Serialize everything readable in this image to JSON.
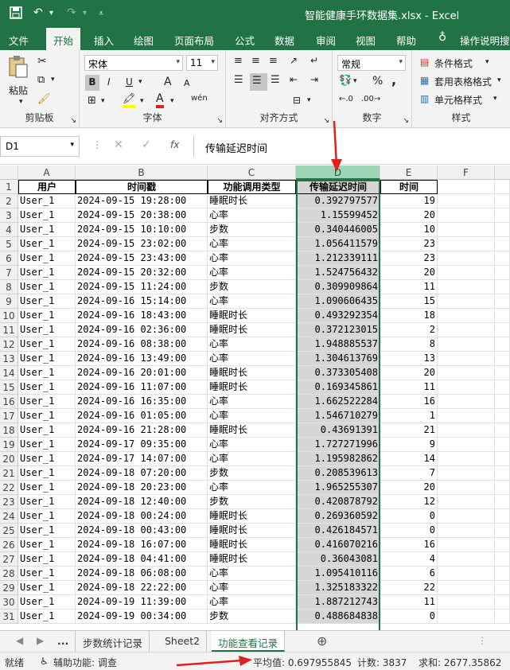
{
  "window": {
    "title": "智能健康手环数据集.xlsx  -  Excel"
  },
  "quick_access": {
    "save": "💾",
    "undo": "↶",
    "redo": "↷",
    "customize": "⌄"
  },
  "tabs": [
    "文件",
    "开始",
    "插入",
    "绘图",
    "页面布局",
    "公式",
    "数据",
    "审阅",
    "视图",
    "帮助"
  ],
  "active_tab": "开始",
  "tell_me": "操作说明搜",
  "ribbon": {
    "clipboard": {
      "label": "剪贴板",
      "paste": "粘贴"
    },
    "font": {
      "label": "字体",
      "name": "宋体",
      "size": "11",
      "bold": "B",
      "italic": "I",
      "underline": "U",
      "grow": "A",
      "shrink": "A",
      "wen": "wén"
    },
    "alignment": {
      "label": "对齐方式"
    },
    "number": {
      "label": "数字",
      "format": "常规",
      "percent": "%",
      "comma": ","
    },
    "styles": {
      "label": "样式",
      "conditional": "条件格式",
      "table": "套用表格格式",
      "cell": "单元格样式"
    }
  },
  "formula_bar": {
    "name_box": "D1",
    "fx": "fx",
    "content": "传输延迟时间"
  },
  "columns": [
    "A",
    "B",
    "C",
    "D",
    "E",
    "F"
  ],
  "selected_column": "D",
  "header_row": [
    "用户",
    "时间戳",
    "功能调用类型",
    "传输延迟时间",
    "时间"
  ],
  "rows": [
    [
      "User_1",
      "2024-09-15 19:28:00",
      "睡眠时长",
      "0.392797577",
      "19"
    ],
    [
      "User_1",
      "2024-09-15 20:38:00",
      "心率",
      "1.15599452",
      "20"
    ],
    [
      "User_1",
      "2024-09-15 10:10:00",
      "步数",
      "0.340446005",
      "10"
    ],
    [
      "User_1",
      "2024-09-15 23:02:00",
      "心率",
      "1.056411579",
      "23"
    ],
    [
      "User_1",
      "2024-09-15 23:43:00",
      "心率",
      "1.212339111",
      "23"
    ],
    [
      "User_1",
      "2024-09-15 20:32:00",
      "心率",
      "1.524756432",
      "20"
    ],
    [
      "User_1",
      "2024-09-15 11:24:00",
      "步数",
      "0.309909864",
      "11"
    ],
    [
      "User_1",
      "2024-09-16 15:14:00",
      "心率",
      "1.090606435",
      "15"
    ],
    [
      "User_1",
      "2024-09-16 18:43:00",
      "睡眠时长",
      "0.493292354",
      "18"
    ],
    [
      "User_1",
      "2024-09-16 02:36:00",
      "睡眠时长",
      "0.372123015",
      "2"
    ],
    [
      "User_1",
      "2024-09-16 08:38:00",
      "心率",
      "1.948885537",
      "8"
    ],
    [
      "User_1",
      "2024-09-16 13:49:00",
      "心率",
      "1.304613769",
      "13"
    ],
    [
      "User_1",
      "2024-09-16 20:01:00",
      "睡眠时长",
      "0.373305408",
      "20"
    ],
    [
      "User_1",
      "2024-09-16 11:07:00",
      "睡眠时长",
      "0.169345861",
      "11"
    ],
    [
      "User_1",
      "2024-09-16 16:35:00",
      "心率",
      "1.662522284",
      "16"
    ],
    [
      "User_1",
      "2024-09-16 01:05:00",
      "心率",
      "1.546710279",
      "1"
    ],
    [
      "User_1",
      "2024-09-16 21:28:00",
      "睡眠时长",
      "0.43691391",
      "21"
    ],
    [
      "User_1",
      "2024-09-17 09:35:00",
      "心率",
      "1.727271996",
      "9"
    ],
    [
      "User_1",
      "2024-09-17 14:07:00",
      "心率",
      "1.195982862",
      "14"
    ],
    [
      "User_1",
      "2024-09-18 07:20:00",
      "步数",
      "0.208539613",
      "7"
    ],
    [
      "User_1",
      "2024-09-18 20:23:00",
      "心率",
      "1.965255307",
      "20"
    ],
    [
      "User_1",
      "2024-09-18 12:40:00",
      "步数",
      "0.420878792",
      "12"
    ],
    [
      "User_1",
      "2024-09-18 00:24:00",
      "睡眠时长",
      "0.269360592",
      "0"
    ],
    [
      "User_1",
      "2024-09-18 00:43:00",
      "睡眠时长",
      "0.426184571",
      "0"
    ],
    [
      "User_1",
      "2024-09-18 16:07:00",
      "睡眠时长",
      "0.416070216",
      "16"
    ],
    [
      "User_1",
      "2024-09-18 04:41:00",
      "睡眠时长",
      "0.36043081",
      "4"
    ],
    [
      "User_1",
      "2024-09-18 06:08:00",
      "心率",
      "1.095410116",
      "6"
    ],
    [
      "User_1",
      "2024-09-18 22:22:00",
      "心率",
      "1.325183322",
      "22"
    ],
    [
      "User_1",
      "2024-09-19 11:39:00",
      "心率",
      "1.887212743",
      "11"
    ],
    [
      "User_1",
      "2024-09-19 00:34:00",
      "步数",
      "0.488684838",
      "0"
    ]
  ],
  "sheets": [
    "...",
    "步数统计记录",
    "Sheet2",
    "功能查看记录"
  ],
  "active_sheet": "功能查看记录",
  "status": {
    "ready": "就绪",
    "accessibility": "辅助功能: 调查",
    "average": "平均值: 0.697955845",
    "count": "计数: 3837",
    "sum": "求和: 2677.35862"
  },
  "colors": {
    "brand": "#217346",
    "selected_header": "#9fd5b7",
    "selected_cells": "#d6d6d6",
    "annotation": "#e02020"
  }
}
